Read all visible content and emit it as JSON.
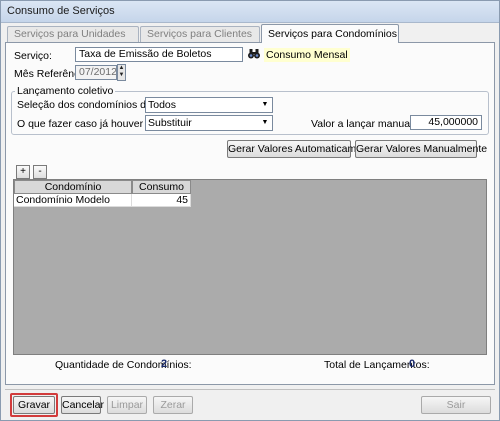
{
  "window": {
    "title": "Consumo de Serviços"
  },
  "tabs": [
    {
      "label": "Serviços para Unidades"
    },
    {
      "label": "Serviços para Clientes"
    },
    {
      "label": "Serviços para Condomínios"
    }
  ],
  "form": {
    "servico_label": "Serviço:",
    "servico_value": "Taxa de Emissão de Boletos",
    "servico_type": "Consumo Mensal",
    "mes_label": "Mês Referência:",
    "mes_value": "07/2012"
  },
  "lancamento": {
    "group_title": "Lançamento coletivo",
    "selecao_label": "Seleção dos condomínios desejados:",
    "selecao_value": "Todos",
    "caso_label": "O que fazer caso já houver valores?",
    "caso_value": "Substituir",
    "valor_label": "Valor a lançar manualmente:",
    "valor_value": "45,000000"
  },
  "actions": {
    "gerar_auto": "Gerar Valores Automaticamente",
    "gerar_manual": "Gerar Valores Manualmente",
    "add": "+",
    "remove": "-"
  },
  "grid": {
    "columns": [
      "Condomínio",
      "Consumo"
    ],
    "rows": [
      {
        "condominio": "Condomínio Modelo",
        "consumo": "45"
      }
    ]
  },
  "summary": {
    "qtd_label": "Quantidade de Condomínios:",
    "qtd_value": "2",
    "total_label": "Total de Lançamentos:",
    "total_value": "0"
  },
  "footer": {
    "gravar": "Gravar",
    "cancelar": "Cancelar",
    "limpar": "Limpar",
    "zerar": "Zerar",
    "sair": "Sair"
  },
  "colors": {
    "highlight_frame": "#d23b3b",
    "summary_value": "#1a2a6c"
  }
}
